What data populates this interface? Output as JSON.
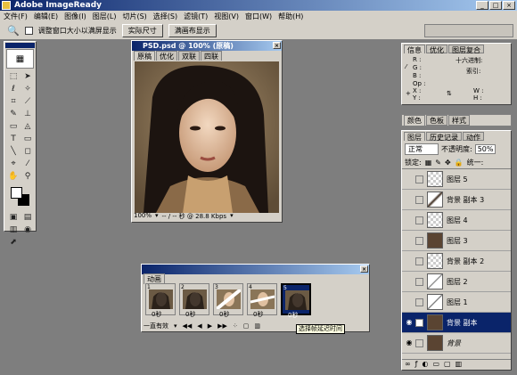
{
  "app": {
    "title": "Adobe ImageReady"
  },
  "menu": [
    "文件(F)",
    "编辑(E)",
    "图像(I)",
    "图层(L)",
    "切片(S)",
    "选择(S)",
    "滤镜(T)",
    "视图(V)",
    "窗口(W)",
    "帮助(H)"
  ],
  "options": {
    "resize_label": "调整窗口大小以满屏显示",
    "actual_size": "实际尺寸",
    "fit_screen": "满画布显示"
  },
  "document": {
    "title": "PSD.psd @ 100% (原稿)",
    "tabs": [
      "原稿",
      "优化",
      "双联",
      "四联"
    ],
    "zoom": "100%",
    "status": "-- / -- 秒 @ 28.8 Kbps"
  },
  "info": {
    "tabs": [
      "信息",
      "优化",
      "图层复合"
    ],
    "r_label": "R :",
    "g_label": "G :",
    "b_label": "B :",
    "op_label": "Op :",
    "hex_label": "十六进制:",
    "index_label": "索引:",
    "x_label": "X :",
    "y_label": "Y :",
    "w_label": "W :",
    "h_label": "H :"
  },
  "color_palette": {
    "tabs": [
      "颜色",
      "色板",
      "样式"
    ]
  },
  "layers_panel": {
    "tabs": [
      "图层",
      "历史记录",
      "动作"
    ],
    "blend_mode": "正常",
    "opacity_label": "不透明度:",
    "opacity": "50%",
    "lock_label": "锁定:",
    "unify_label": "统一:",
    "layers": [
      {
        "name": "图层 5",
        "visible": false,
        "selected": false
      },
      {
        "name": "背景 副本 3",
        "visible": false,
        "selected": false
      },
      {
        "name": "图层 4",
        "visible": false,
        "selected": false
      },
      {
        "name": "图层 3",
        "visible": false,
        "selected": false
      },
      {
        "name": "背景 副本 2",
        "visible": false,
        "selected": false
      },
      {
        "name": "图层 2",
        "visible": false,
        "selected": false
      },
      {
        "name": "图层 1",
        "visible": false,
        "selected": false
      },
      {
        "name": "背景 副本",
        "visible": true,
        "selected": true
      },
      {
        "name": "背景",
        "visible": true,
        "selected": false
      }
    ]
  },
  "animation": {
    "title": "动画",
    "loop": "一直有效",
    "frames": [
      {
        "num": "1",
        "delay": "0秒"
      },
      {
        "num": "2",
        "delay": "0秒"
      },
      {
        "num": "3",
        "delay": "0秒"
      },
      {
        "num": "4",
        "delay": "0秒"
      },
      {
        "num": "5",
        "delay": "0秒"
      }
    ],
    "selected_frame": 4,
    "tooltip": "选择帧延迟时间"
  }
}
